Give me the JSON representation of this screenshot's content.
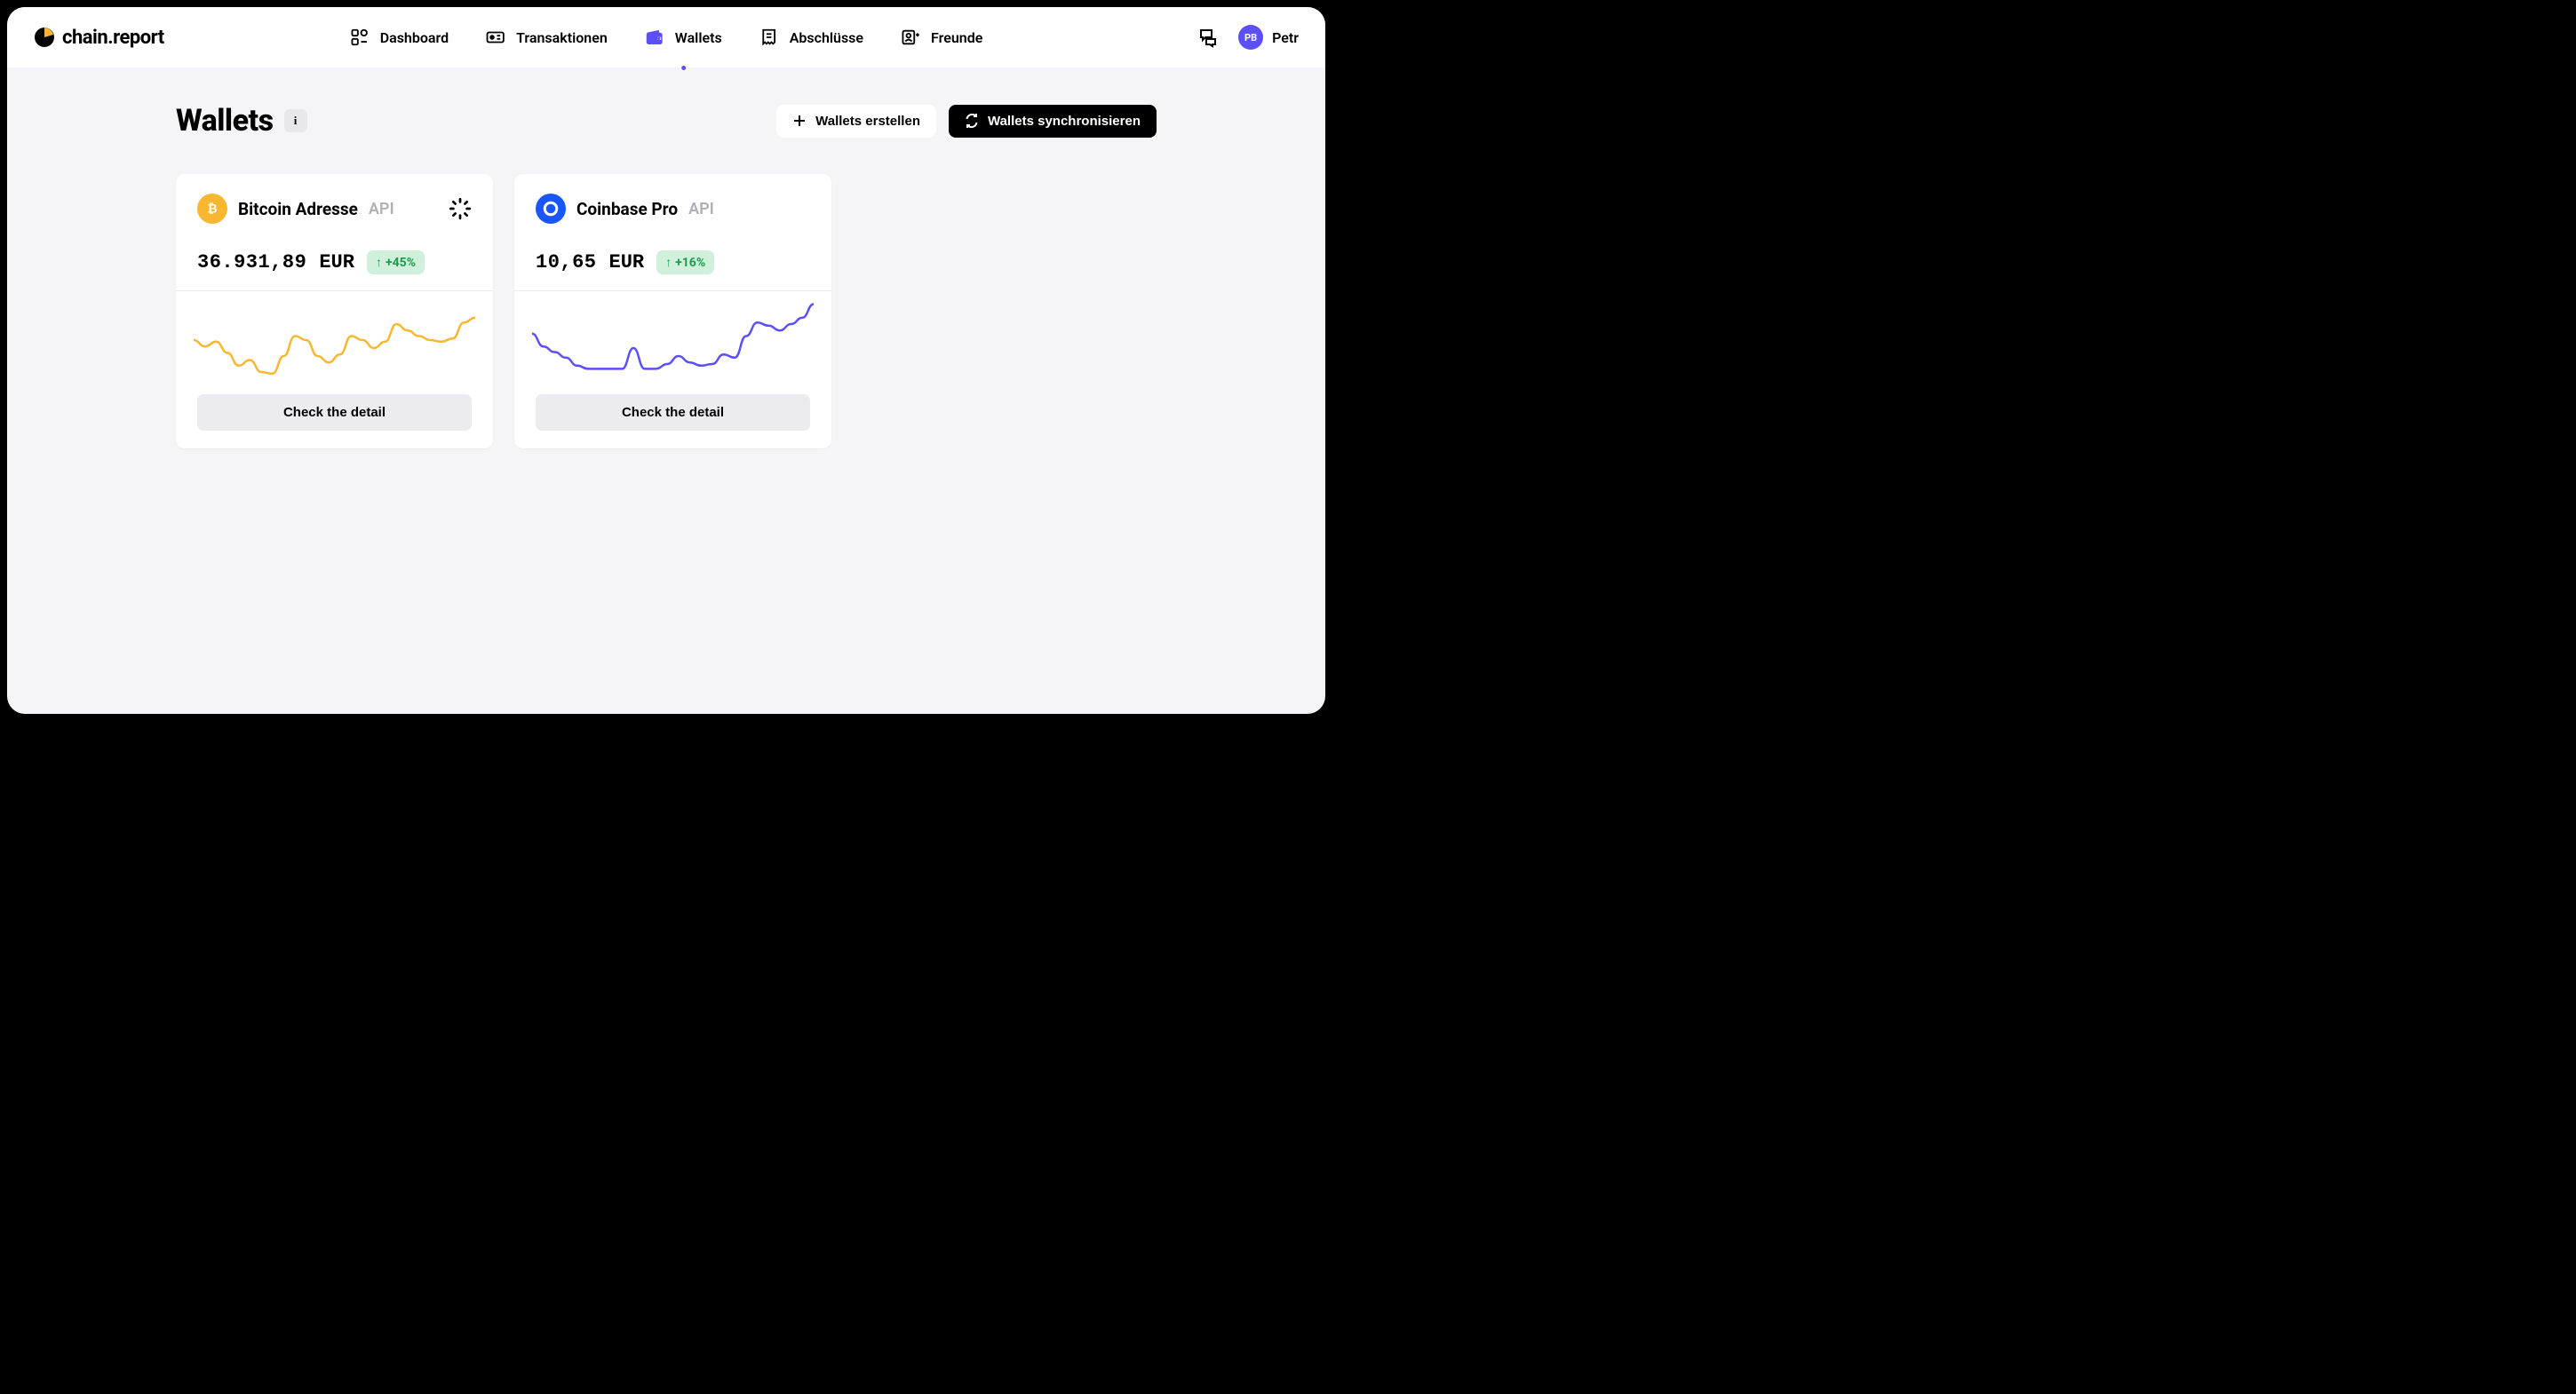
{
  "brand": "chain.report",
  "nav": {
    "dashboard": "Dashboard",
    "transactions": "Transaktionen",
    "wallets": "Wallets",
    "closings": "Abschlüsse",
    "friends": "Freunde"
  },
  "user": {
    "initials": "PB",
    "name": "Petr"
  },
  "page": {
    "title": "Wallets",
    "info": "i"
  },
  "actions": {
    "create": "Wallets erstellen",
    "sync": "Wallets synchronisieren"
  },
  "wallets": [
    {
      "id": "btc",
      "name": "Bitcoin Adresse",
      "tag": "API",
      "amount": "36.931,89",
      "currency": "EUR",
      "change": "+45%",
      "loading": true,
      "color": "#f7b731",
      "detail_label": "Check the detail",
      "sparkline": [
        50,
        42,
        48,
        34,
        18,
        25,
        10,
        8,
        30,
        55,
        50,
        30,
        22,
        32,
        55,
        50,
        40,
        48,
        70,
        62,
        55,
        50,
        48,
        52,
        72,
        78
      ]
    },
    {
      "id": "cbp",
      "name": "Coinbase Pro",
      "tag": "API",
      "amount": "10,65",
      "currency": "EUR",
      "change": "+16%",
      "loading": false,
      "color": "#5b4ff5",
      "detail_label": "Check the detail",
      "sparkline": [
        58,
        42,
        35,
        28,
        18,
        14,
        14,
        14,
        14,
        40,
        14,
        14,
        20,
        30,
        22,
        18,
        20,
        32,
        28,
        55,
        72,
        68,
        62,
        70,
        78,
        95
      ]
    }
  ]
}
